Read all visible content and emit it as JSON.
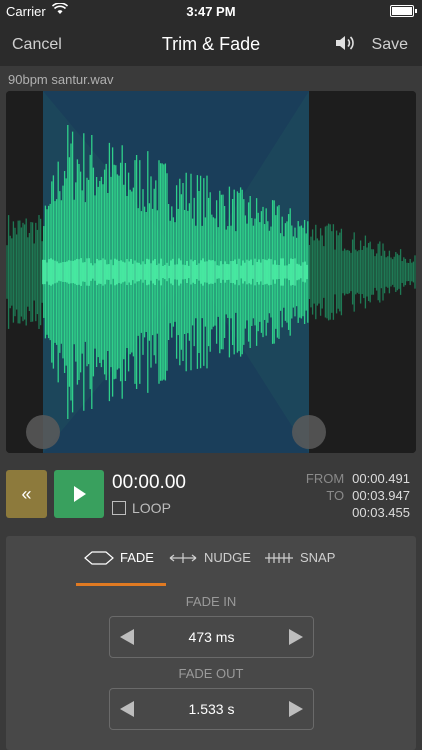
{
  "status": {
    "carrier": "Carrier",
    "time": "3:47 PM",
    "battery_level": 1.0
  },
  "nav": {
    "cancel": "Cancel",
    "title": "Trim & Fade",
    "save": "Save"
  },
  "file": {
    "name": "90bpm santur.wav"
  },
  "transport": {
    "current_time": "00:00.00",
    "loop_label": "LOOP",
    "from_label": "FROM",
    "from_value": "00:00.491",
    "to_label": "TO",
    "to_value": "00:03.947",
    "duration": "00:03.455"
  },
  "tabs": [
    {
      "label": "FADE",
      "active": true
    },
    {
      "label": "NUDGE",
      "active": false
    },
    {
      "label": "SNAP",
      "active": false
    }
  ],
  "fade_in": {
    "label": "FADE IN",
    "value": "473 ms"
  },
  "fade_out": {
    "label": "FADE OUT",
    "value": "1.533 s"
  },
  "colors": {
    "waveform": "#2fd08a",
    "selection": "#1a3e5a",
    "accent": "#e07a22",
    "rewind": "#8d7a3c",
    "play": "#39a05e"
  }
}
